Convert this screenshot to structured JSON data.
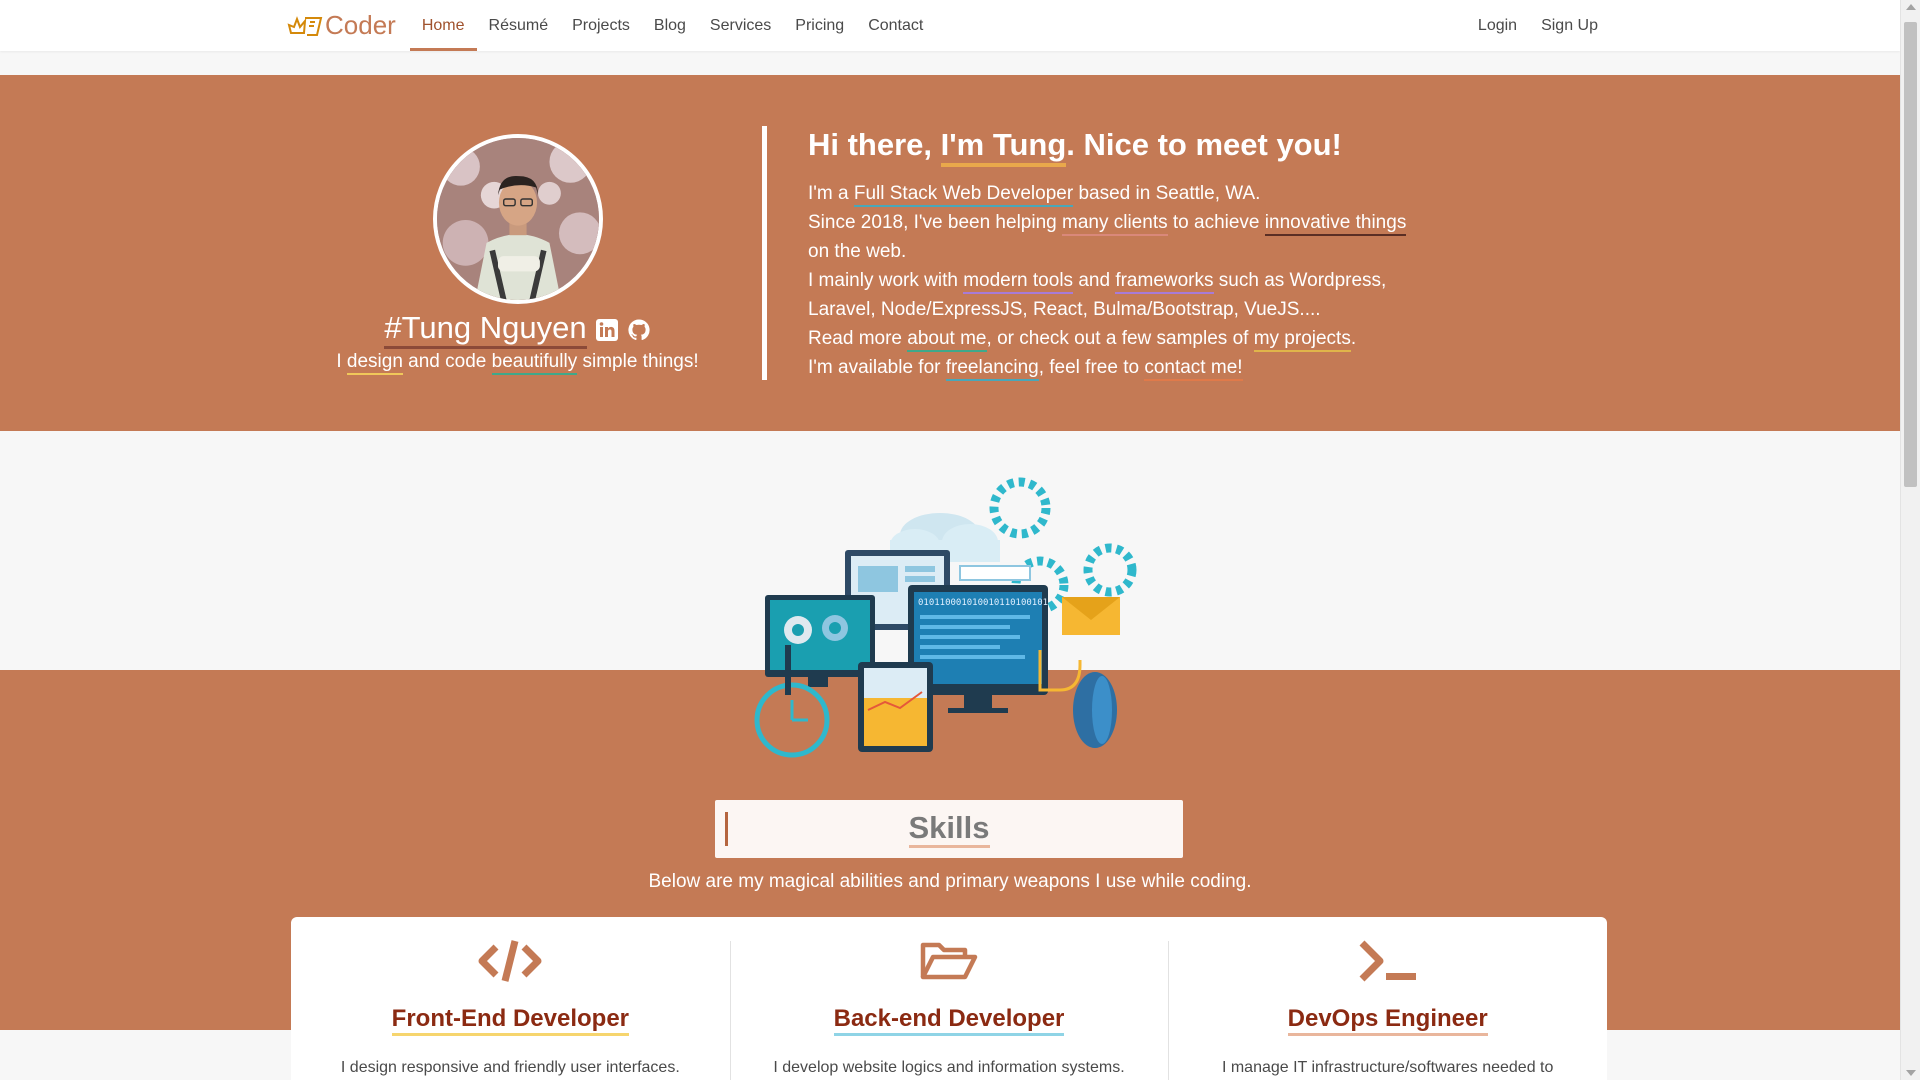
{
  "nav": {
    "logo_text": "Coder",
    "items": [
      "Home",
      "Résumé",
      "Projects",
      "Blog",
      "Services",
      "Pricing",
      "Contact"
    ],
    "active": "Home",
    "right": [
      "Login",
      "Sign Up"
    ]
  },
  "profile": {
    "name": "#Tung Nguyen",
    "tagline": {
      "t1": "I ",
      "design": "design",
      "t2": " and code ",
      "beautifully": "beautifully",
      "t3": " simple things!"
    },
    "icons": [
      "linkedin-icon",
      "github-icon"
    ]
  },
  "intro": {
    "heading": {
      "pre": "Hi there, ",
      "name": "I'm Tung",
      "post": ". Nice to meet you!"
    },
    "line1": {
      "a": "I'm a ",
      "b": "Full Stack Web Developer",
      "c": " based in Seattle, WA."
    },
    "line2": {
      "a": "Since 2018, I've been helping ",
      "b": "many clients",
      "c": " to achieve ",
      "d": "innovative things"
    },
    "line3": "on the web.",
    "line4": {
      "a": "I mainly work with ",
      "b": "modern tools",
      "c": " and ",
      "d": "frameworks",
      "e": " such as Wordpress,"
    },
    "line5": "Laravel, Node/ExpressJS, React, Bulma/Bootstrap, VueJS....",
    "line6": {
      "a": "Read more ",
      "b": "about me",
      "c": ", or check out a few samples of ",
      "d": "my projects",
      "e": "."
    },
    "line7": {
      "a": "I'm available for ",
      "b": "freelancing",
      "c": ", feel free to ",
      "d": "contact me!"
    }
  },
  "skills": {
    "title": "Skills",
    "subtitle": "Below are my magical abilities and primary weapons I use while coding.",
    "cards": [
      {
        "icon": "code-icon",
        "title": "Front-End Developer",
        "desc": "I design responsive and friendly user interfaces."
      },
      {
        "icon": "folder-open-icon",
        "title": "Back-end Developer",
        "desc": "I develop website logics and information systems."
      },
      {
        "icon": "terminal-icon",
        "title": "DevOps Engineer",
        "desc": "I manage IT infrastructure/softwares needed to"
      }
    ]
  },
  "illustration": {
    "binary_text": "010110001010010110100101"
  },
  "colors": {
    "brand": "#c47a55",
    "accent_dark": "#8b2a12",
    "background": "#f7f7f7"
  }
}
